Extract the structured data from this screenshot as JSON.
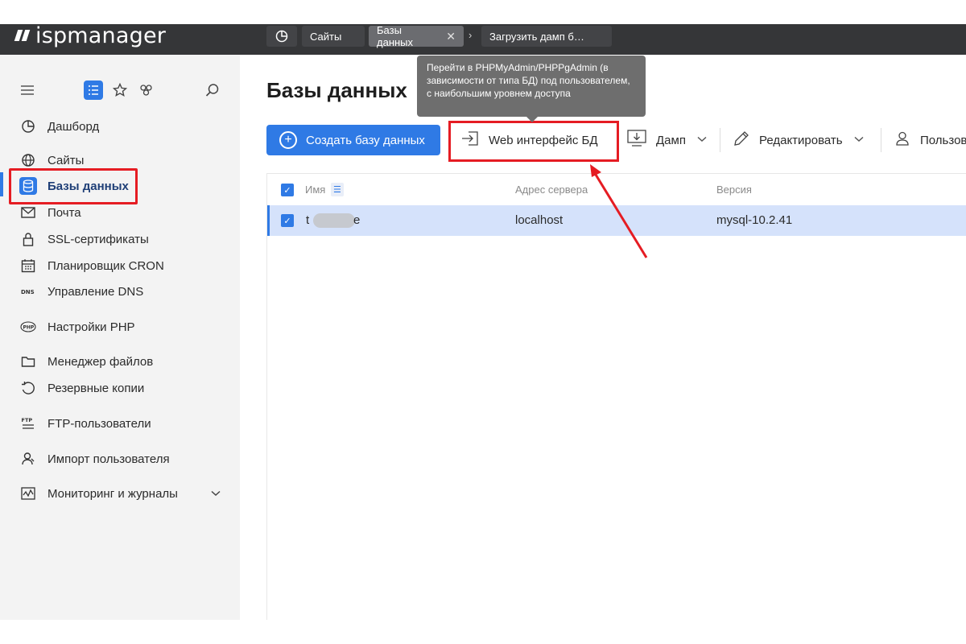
{
  "app": {
    "logo_text": "ispmanager"
  },
  "tabs": {
    "home_icon": "dashboard-icon",
    "sites": "Сайты",
    "active": "Базы данных",
    "active_close": "✕",
    "separator": "›",
    "dump": "Загрузить дамп б…"
  },
  "sidebar": {
    "tools": [
      "menu-icon",
      "list-icon",
      "star-icon",
      "apps-icon",
      "search-icon"
    ],
    "items": [
      {
        "label": "Дашборд",
        "icon": "dashboard-icon"
      },
      {
        "label": "Сайты",
        "icon": "globe-icon"
      },
      {
        "label": "Базы данных",
        "icon": "database-icon"
      },
      {
        "label": "Почта",
        "icon": "mail-icon"
      },
      {
        "label": "SSL-сертификаты",
        "icon": "lock-icon"
      },
      {
        "label": "Планировщик CRON",
        "icon": "calendar-icon"
      },
      {
        "label": "Управление DNS",
        "icon": "dns-icon"
      },
      {
        "label": "Настройки PHP",
        "icon": "php-icon"
      },
      {
        "label": "Менеджер файлов",
        "icon": "folder-icon"
      },
      {
        "label": "Резервные копии",
        "icon": "backup-icon"
      },
      {
        "label": "FTP-пользователи",
        "icon": "ftp-icon"
      },
      {
        "label": "Импорт пользователя",
        "icon": "user-import-icon"
      },
      {
        "label": "Мониторинг и журналы",
        "icon": "monitoring-icon"
      }
    ]
  },
  "page": {
    "title": "Базы данных"
  },
  "toolbar": {
    "create": "Создать базу данных",
    "web": "Web интерфейс БД",
    "dump": "Дамп",
    "edit": "Редактировать",
    "users": "Пользов"
  },
  "tooltip": {
    "text": "Перейти в PHPMyAdmin/PHPPgAdmin (в зависимости от типа БД) под пользователем, с наибольшим уровнем доступа"
  },
  "table": {
    "columns": {
      "name": "Имя",
      "address": "Адрес сервера",
      "version": "Версия"
    },
    "rows": [
      {
        "name_start": "t",
        "name_end": "e",
        "address": "localhost",
        "version": "mysql-10.2.41",
        "selected": true
      }
    ]
  },
  "colors": {
    "accent": "#2f7ae5",
    "annotation": "#e51c23",
    "topbar": "#353638",
    "selected_row": "#d5e2fb"
  }
}
